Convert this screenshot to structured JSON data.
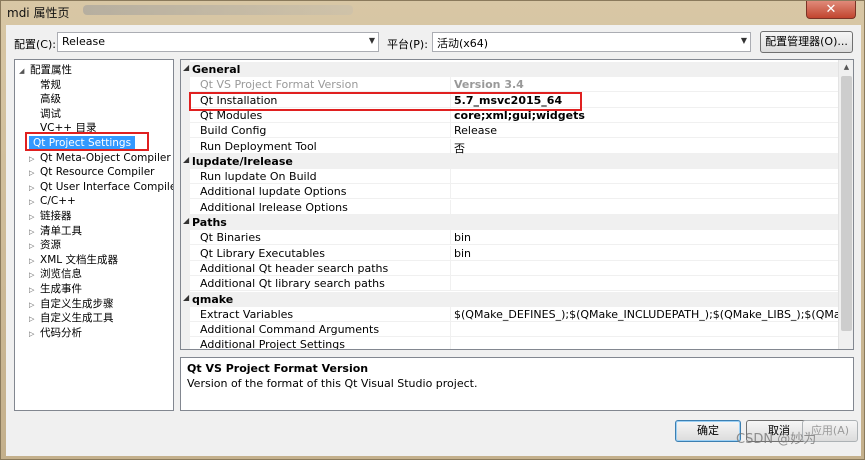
{
  "window": {
    "title": "mdi 属性页"
  },
  "toolbar": {
    "config_label": "配置(C):",
    "config_value": "Release",
    "platform_label": "平台(P):",
    "platform_value": "活动(x64)",
    "manager_label": "配置管理器(O)..."
  },
  "tree": {
    "items": [
      {
        "label": "配置属性",
        "twisty": "◢"
      },
      {
        "label": "常规",
        "twisty": ""
      },
      {
        "label": "高级",
        "twisty": ""
      },
      {
        "label": "调试",
        "twisty": ""
      },
      {
        "label": "VC++ 目录",
        "twisty": ""
      },
      {
        "label": "Qt Project Settings",
        "twisty": ""
      },
      {
        "label": "Qt Meta-Object Compiler",
        "twisty": "▷"
      },
      {
        "label": "Qt Resource Compiler",
        "twisty": "▷"
      },
      {
        "label": "Qt User Interface Compiler",
        "twisty": "▷"
      },
      {
        "label": "C/C++",
        "twisty": "▷"
      },
      {
        "label": "链接器",
        "twisty": "▷"
      },
      {
        "label": "清单工具",
        "twisty": "▷"
      },
      {
        "label": "资源",
        "twisty": "▷"
      },
      {
        "label": "XML 文档生成器",
        "twisty": "▷"
      },
      {
        "label": "浏览信息",
        "twisty": "▷"
      },
      {
        "label": "生成事件",
        "twisty": "▷"
      },
      {
        "label": "自定义生成步骤",
        "twisty": "▷"
      },
      {
        "label": "自定义生成工具",
        "twisty": "▷"
      },
      {
        "label": "代码分析",
        "twisty": "▷"
      }
    ]
  },
  "grid": {
    "rows": [
      {
        "type": "cat",
        "name": "General",
        "value": ""
      },
      {
        "type": "prop",
        "name": "Qt VS Project Format Version",
        "value": "Version 3.4",
        "greyed": true,
        "bold": true
      },
      {
        "type": "prop",
        "name": "Qt Installation",
        "value": "5.7_msvc2015_64",
        "bold": true
      },
      {
        "type": "prop",
        "name": "Qt Modules",
        "value": "core;xml;gui;widgets",
        "bold": true
      },
      {
        "type": "prop",
        "name": "Build Config",
        "value": "Release"
      },
      {
        "type": "prop",
        "name": "Run Deployment Tool",
        "value": "否"
      },
      {
        "type": "cat",
        "name": "lupdate/lrelease",
        "value": ""
      },
      {
        "type": "prop",
        "name": "Run lupdate On Build",
        "value": ""
      },
      {
        "type": "prop",
        "name": "Additional lupdate Options",
        "value": ""
      },
      {
        "type": "prop",
        "name": "Additional lrelease Options",
        "value": ""
      },
      {
        "type": "cat",
        "name": "Paths",
        "value": ""
      },
      {
        "type": "prop",
        "name": "Qt Binaries",
        "value": "bin"
      },
      {
        "type": "prop",
        "name": "Qt Library Executables",
        "value": "bin"
      },
      {
        "type": "prop",
        "name": "Additional Qt header search paths",
        "value": ""
      },
      {
        "type": "prop",
        "name": "Additional Qt library search paths",
        "value": ""
      },
      {
        "type": "cat",
        "name": "qmake",
        "value": ""
      },
      {
        "type": "prop",
        "name": "Extract Variables",
        "value": "$(QMake_DEFINES_);$(QMake_INCLUDEPATH_);$(QMake_LIBS_);$(QMake_LIBPATH_)"
      },
      {
        "type": "prop",
        "name": "Additional Command Arguments",
        "value": ""
      },
      {
        "type": "prop",
        "name": "Additional Project Settings",
        "value": ""
      }
    ]
  },
  "description": {
    "title": "Qt VS Project Format Version",
    "text": "Version of the format of this Qt Visual Studio project."
  },
  "buttons": {
    "ok": "确定",
    "cancel": "取消",
    "apply": "应用(A)"
  },
  "watermark": "CSDN @妙为"
}
